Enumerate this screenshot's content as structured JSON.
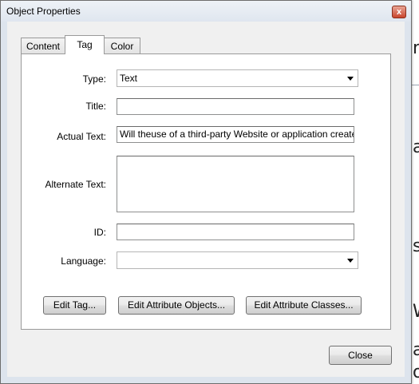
{
  "window": {
    "title": "Object Properties",
    "close_glyph": "x"
  },
  "tabs": [
    {
      "label": "Content"
    },
    {
      "label": "Tag"
    },
    {
      "label": "Color"
    }
  ],
  "form": {
    "type_label": "Type:",
    "type_value": "Text",
    "title_label": "Title:",
    "title_value": "",
    "actual_text_label": "Actual Text:",
    "actual_text_value": "Will theuse of a third-party Website or application create",
    "alternate_text_label": "Alternate Text:",
    "alternate_text_value": "",
    "id_label": "ID:",
    "id_value": "",
    "language_label": "Language:",
    "language_value": ""
  },
  "buttons": {
    "edit_tag": "Edit Tag...",
    "edit_attribute_objects": "Edit Attribute Objects...",
    "edit_attribute_classes": "Edit Attribute Classes...",
    "close": "Close"
  },
  "background_doc": {
    "frags": [
      "n",
      "a",
      "s",
      "W",
      "a",
      "oe"
    ]
  }
}
